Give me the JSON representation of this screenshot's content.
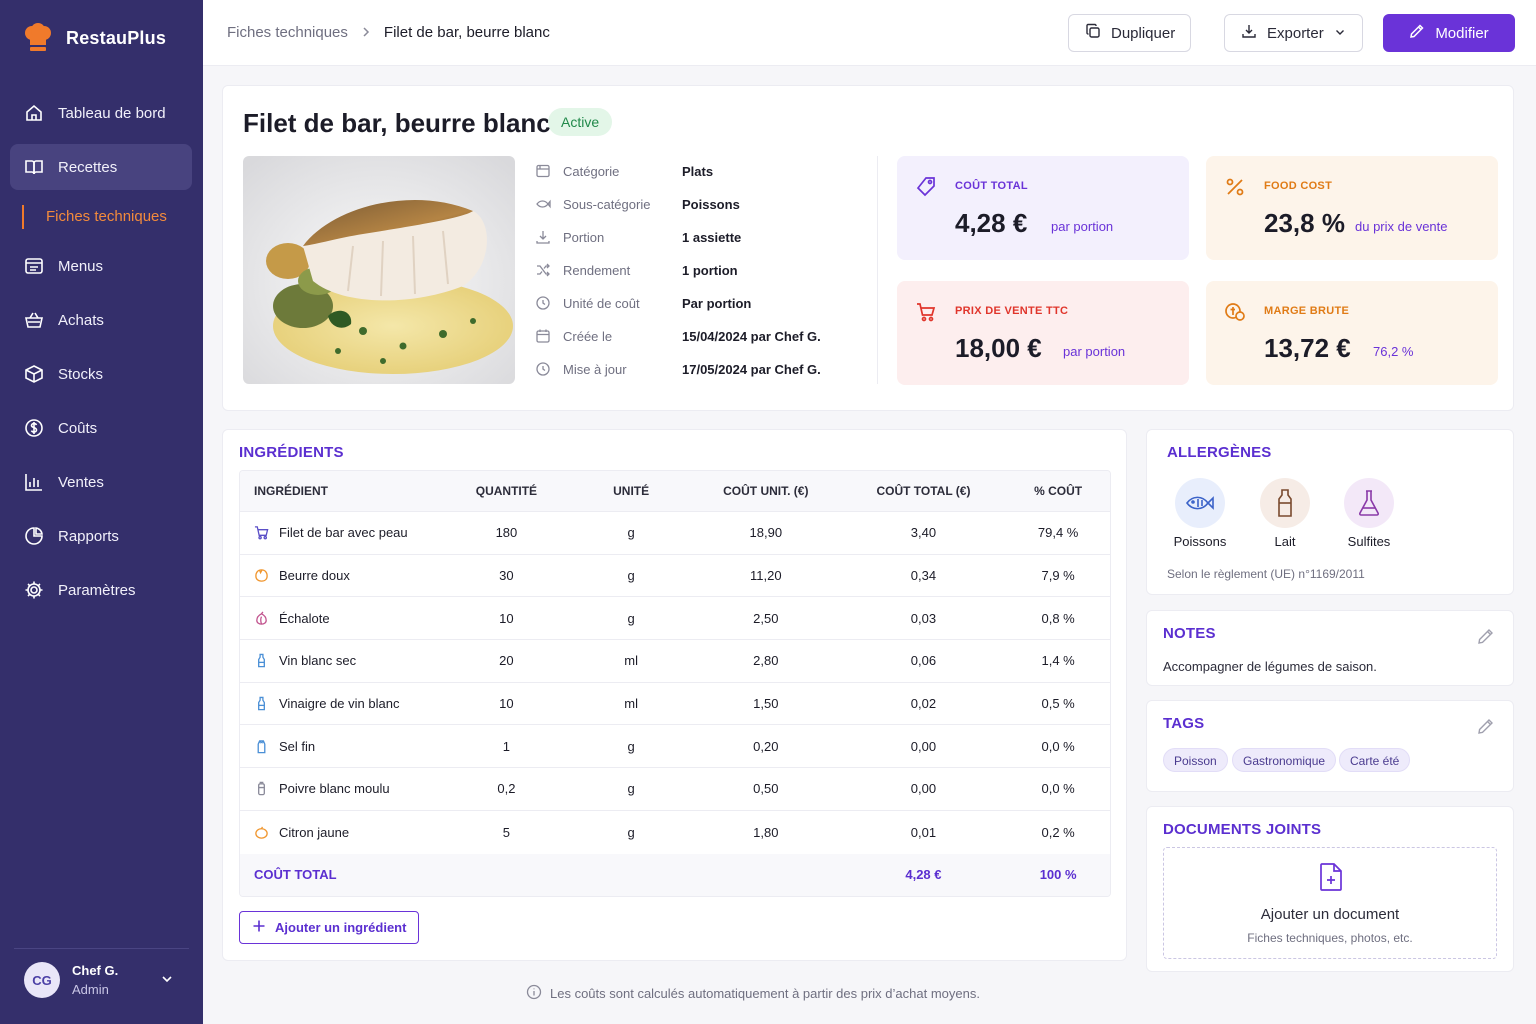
{
  "app": {
    "name": "RestauPlus"
  },
  "nav": {
    "items": [
      {
        "label": "Tableau de bord",
        "icon": "home-icon"
      },
      {
        "label": "Recettes",
        "icon": "book-icon",
        "active": true
      },
      {
        "label": "Menus",
        "icon": "menu-icon"
      },
      {
        "label": "Achats",
        "icon": "basket-icon"
      },
      {
        "label": "Stocks",
        "icon": "box-icon"
      },
      {
        "label": "Coûts",
        "icon": "dollar-icon"
      },
      {
        "label": "Ventes",
        "icon": "chart-icon"
      },
      {
        "label": "Rapports",
        "icon": "pie-icon"
      },
      {
        "label": "Paramètres",
        "icon": "gear-icon"
      }
    ],
    "sub_item": "Fiches techniques"
  },
  "user": {
    "initials": "CG",
    "name": "Chef G.",
    "role": "Admin"
  },
  "header": {
    "breadcrumb_parent": "Fiches techniques",
    "breadcrumb_current": "Filet de bar, beurre blanc",
    "duplicate_label": "Dupliquer",
    "export_label": "Exporter",
    "edit_label": "Modifier"
  },
  "recipe": {
    "title": "Filet de bar, beurre blanc",
    "status": "Active",
    "meta": [
      {
        "label": "Catégorie",
        "value": "Plats",
        "icon": "flag-icon"
      },
      {
        "label": "Sous-catégorie",
        "value": "Poissons",
        "icon": "fish-icon"
      },
      {
        "label": "Portion",
        "value": "1 assiette",
        "icon": "download-icon"
      },
      {
        "label": "Rendement",
        "value": "1 portion",
        "icon": "shuffle-icon"
      },
      {
        "label": "Unité de coût",
        "value": "Par portion",
        "icon": "clock-icon"
      },
      {
        "label": "Créée le",
        "value": "15/04/2024 par Chef G.",
        "icon": "calendar-icon"
      },
      {
        "label": "Mise à jour",
        "value": "17/05/2024 par Chef G.",
        "icon": "clock-icon"
      }
    ]
  },
  "stats": {
    "total_cost": {
      "label": "COÛT TOTAL",
      "value": "4,28 €",
      "sub": "par portion",
      "color": "#6a33d8"
    },
    "food_cost": {
      "label": "FOOD COST",
      "value": "23,8 %",
      "sub": "du prix de vente",
      "color": "#e07b16"
    },
    "sale_price": {
      "label": "PRIX DE VENTE TTC",
      "value": "18,00 €",
      "sub": "par portion",
      "color": "#e0352b"
    },
    "gross_margin": {
      "label": "MARGE BRUTE",
      "value": "13,72 €",
      "sub": "76,2 %",
      "color": "#e07b16"
    }
  },
  "ingredients": {
    "title": "INGRÉDIENTS",
    "columns": [
      "INGRÉDIENT",
      "QUANTITÉ",
      "UNITÉ",
      "COÛT UNIT. (€)",
      "COÛT TOTAL (€)",
      "% COÛT"
    ],
    "rows": [
      {
        "name": "Filet de bar avec peau",
        "qty": "180",
        "unit": "g",
        "unit_cost": "18,90",
        "total": "3,40",
        "pct": "79,4 %",
        "icon": "cart-icon",
        "color": "#5b4fc7"
      },
      {
        "name": "Beurre doux",
        "qty": "30",
        "unit": "g",
        "unit_cost": "11,20",
        "total": "0,34",
        "pct": "7,9 %",
        "icon": "butter-icon",
        "color": "#f0962e"
      },
      {
        "name": "Échalote",
        "qty": "10",
        "unit": "g",
        "unit_cost": "2,50",
        "total": "0,03",
        "pct": "0,8 %",
        "icon": "shallot-icon",
        "color": "#c2558f"
      },
      {
        "name": "Vin blanc sec",
        "qty": "20",
        "unit": "ml",
        "unit_cost": "2,80",
        "total": "0,06",
        "pct": "1,4 %",
        "icon": "bottle-icon",
        "color": "#4a8fd6"
      },
      {
        "name": "Vinaigre de vin blanc",
        "qty": "10",
        "unit": "ml",
        "unit_cost": "1,50",
        "total": "0,02",
        "pct": "0,5 %",
        "icon": "bottle-icon",
        "color": "#4a8fd6"
      },
      {
        "name": "Sel fin",
        "qty": "1",
        "unit": "g",
        "unit_cost": "0,20",
        "total": "0,00",
        "pct": "0,0 %",
        "icon": "salt-icon",
        "color": "#4a8fd6"
      },
      {
        "name": "Poivre blanc moulu",
        "qty": "0,2",
        "unit": "g",
        "unit_cost": "0,50",
        "total": "0,00",
        "pct": "0,0 %",
        "icon": "pepper-icon",
        "color": "#8a8a99"
      },
      {
        "name": "Citron jaune",
        "qty": "5",
        "unit": "g",
        "unit_cost": "1,80",
        "total": "0,01",
        "pct": "0,2 %",
        "icon": "lemon-icon",
        "color": "#f0962e"
      }
    ],
    "footer": {
      "label": "COÛT TOTAL",
      "total": "4,28 €",
      "pct": "100 %"
    },
    "add_label": "Ajouter un ingrédient"
  },
  "allergens": {
    "title": "ALLERGÈNES",
    "items": [
      {
        "label": "Poissons",
        "icon": "fish-icon",
        "bg": "#e8eefc",
        "color": "#3b63c9"
      },
      {
        "label": "Lait",
        "icon": "milk-bottle-icon",
        "bg": "#f6ece6",
        "color": "#7a4a2e"
      },
      {
        "label": "Sulfites",
        "icon": "flask-icon",
        "bg": "#f3e8f8",
        "color": "#8a3aa8"
      }
    ],
    "note": "Selon le règlement (UE) n°1169/2011"
  },
  "notes": {
    "title": "NOTES",
    "text": "Accompagner de légumes de saison."
  },
  "tags": {
    "title": "TAGS",
    "items": [
      "Poisson",
      "Gastronomique",
      "Carte été"
    ]
  },
  "documents": {
    "title": "DOCUMENTS JOINTS",
    "add_label": "Ajouter un document",
    "hint": "Fiches techniques, photos, etc."
  },
  "footnote": "Les coûts sont calculés automatiquement à partir des prix d’achat moyens."
}
